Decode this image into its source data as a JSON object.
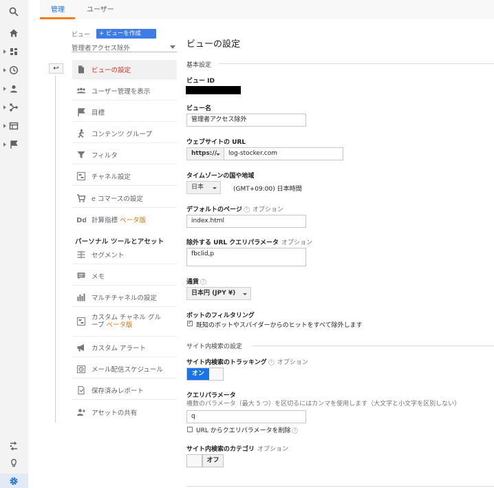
{
  "tabs": {
    "admin": "管理",
    "user": "ユーザー"
  },
  "view_picker": {
    "label": "ビュー",
    "create_button": "+ ビューを作成",
    "selected_view": "管理者アクセス除外"
  },
  "menu": {
    "items": [
      {
        "label": "ビューの設定",
        "icon": "document-icon",
        "selected": true
      },
      {
        "label": "ユーザー管理を表示",
        "icon": "users-icon"
      },
      {
        "label": "目標",
        "icon": "flag-icon"
      },
      {
        "label": "コンテンツ グループ",
        "icon": "person-walk-icon"
      },
      {
        "label": "フィルタ",
        "icon": "filter-icon"
      },
      {
        "label": "チャネル設定",
        "icon": "channel-icon"
      },
      {
        "label": "e コマースの設定",
        "icon": "cart-icon"
      },
      {
        "label": "計算指標",
        "beta": "ベータ版",
        "icon": "dd-icon"
      }
    ],
    "section_header": "パーソナル ツールとアセット",
    "personal_items": [
      {
        "label": "セグメント",
        "icon": "segment-icon"
      },
      {
        "label": "メモ",
        "icon": "memo-icon"
      },
      {
        "label": "マルチチャネルの設定",
        "icon": "bar-chart-icon"
      },
      {
        "label_line1": "カスタム チャネル グル",
        "label_line2": "ープ",
        "beta": "ベータ版",
        "icon": "channel-group-icon"
      },
      {
        "label": "カスタム アラート",
        "icon": "megaphone-icon"
      },
      {
        "label": "メール配信スケジュール",
        "icon": "clock-icon"
      },
      {
        "label": "保存済みレポート",
        "icon": "saved-doc-icon"
      },
      {
        "label": "アセットの共有",
        "icon": "share-person-icon"
      }
    ]
  },
  "settings": {
    "title": "ビューの設定",
    "basic_section": "基本設定",
    "view_id_label": "ビュー ID",
    "view_name_label": "ビュー名",
    "view_name_value": "管理者アクセス除外",
    "website_url_label": "ウェブサイトの URL",
    "protocol": "https://",
    "website_url_value": "log-stocker.com",
    "timezone_label": "タイムゾーンの国や地域",
    "timezone_country": "日本",
    "timezone_value": "(GMT+09:00) 日本時間",
    "default_page_label": "デフォルトのページ",
    "default_page_optional": "オプション",
    "default_page_value": "index.html",
    "exclude_params_label": "除外する URL クエリパラメータ",
    "exclude_params_optional": "オプション",
    "exclude_params_value": "fbclid,p",
    "currency_label": "通貨",
    "currency_value": "日本円 (JPY ¥)",
    "bot_filter_label": "ボットのフィルタリング",
    "bot_filter_checkbox": "既知のボットやスパイダーからのヒットをすべて除外します",
    "bot_filter_checked": true,
    "site_search_section": "サイト内検索の設定",
    "site_search_tracking_label": "サイト内検索のトラッキング",
    "site_search_tracking_optional": "オプション",
    "toggle_on": "オン",
    "query_param_label": "クエリパラメータ",
    "query_param_hint": "複数のパラメータ（最大 5 つ）を区切るにはカンマを使用します（大文字と小文字を区別しない）",
    "query_param_value": "q",
    "remove_param_checkbox": "URL からクエリパラメータを削除",
    "site_search_category_label": "サイト内検索のカテゴリ",
    "site_search_category_optional": "オプション",
    "toggle_off": "オフ"
  },
  "colors": {
    "accent_blue": "#1a73e8",
    "accent_orange": "#fa7b17",
    "selected_red": "#d93025"
  }
}
